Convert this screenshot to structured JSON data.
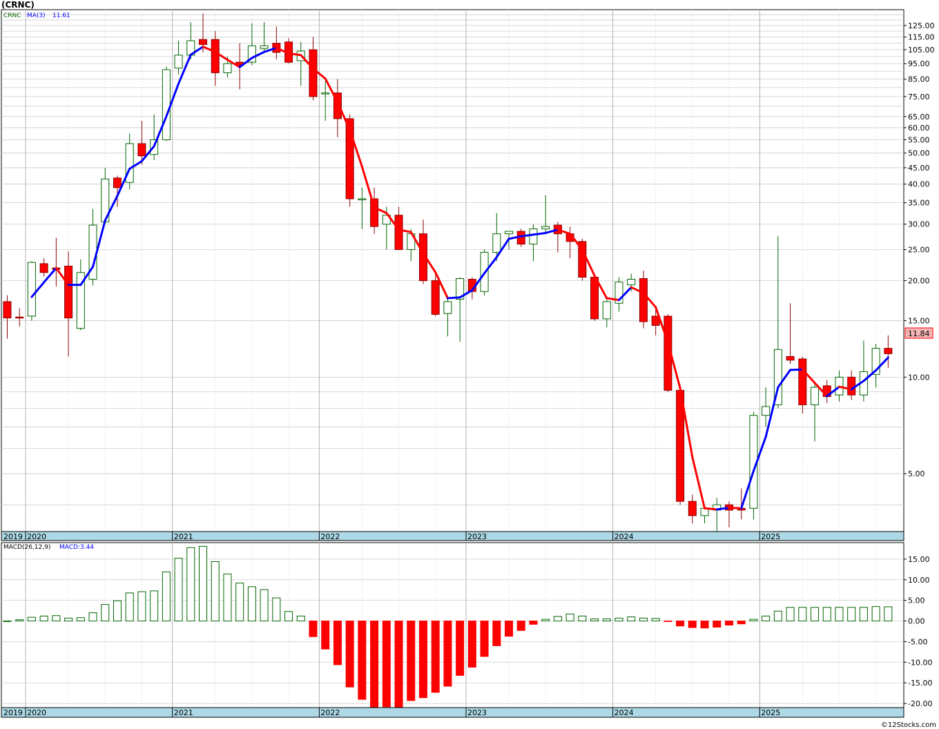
{
  "title": "(CRNC)",
  "watermark": "©12Stocks.com",
  "colors": {
    "up_fill": "#ffffff",
    "up_stroke": "#006400",
    "down_fill": "#ff0000",
    "down_stroke": "#8b0000",
    "ma_up": "#0000ff",
    "ma_down": "#ff0000",
    "grid": "#cccccc",
    "axis_band": "#add8e6",
    "last_price_bg": "#f4b4b4"
  },
  "price_panel": {
    "ticker_label": "CRNC",
    "ma_label": "MA(3)",
    "ma_value": "11.61",
    "last_price": "11.84",
    "y_scale": "log",
    "ylim": [
      3.3,
      140
    ],
    "y_ticks": [
      "125.00",
      "115.00",
      "105.00",
      "95.00",
      "85.00",
      "75.00",
      "65.00",
      "60.00",
      "55.00",
      "50.00",
      "45.00",
      "40.00",
      "35.00",
      "30.00",
      "25.00",
      "20.00",
      "15.00",
      "10.00",
      "5.00"
    ]
  },
  "macd_panel": {
    "label": "MACD(26,12,9)",
    "value_label": "MACD:3.44",
    "ylim": [
      -21,
      19
    ],
    "y_ticks": [
      "15.00",
      "10.00",
      "5.00",
      "0.00",
      "-5.00",
      "-10.00",
      "-15.00",
      "-20.00"
    ]
  },
  "x_axis": {
    "year_labels": [
      "2019",
      "2020",
      "2021",
      "2022",
      "2023",
      "2024",
      "2025"
    ]
  },
  "chart_data": [
    {
      "type": "candlestick",
      "interval": "monthly",
      "ylabel": "",
      "y_scale": "log",
      "series": [
        {
          "date": "2019-11",
          "open": 17.2,
          "high": 18.0,
          "low": 13.2,
          "close": 15.3
        },
        {
          "date": "2019-12",
          "open": 15.4,
          "high": 16.4,
          "low": 14.4,
          "close": 15.3
        },
        {
          "date": "2020-01",
          "open": 15.5,
          "high": 23.0,
          "low": 15.0,
          "close": 22.8
        },
        {
          "date": "2020-02",
          "open": 22.6,
          "high": 23.5,
          "low": 20.6,
          "close": 21.2
        },
        {
          "date": "2020-03",
          "open": 21.9,
          "high": 27.2,
          "low": 19.2,
          "close": 21.7
        },
        {
          "date": "2020-04",
          "open": 22.2,
          "high": 24.7,
          "low": 11.6,
          "close": 15.3
        },
        {
          "date": "2020-05",
          "open": 14.2,
          "high": 23.3,
          "low": 14.0,
          "close": 21.2
        },
        {
          "date": "2020-06",
          "open": 20.2,
          "high": 33.5,
          "low": 19.3,
          "close": 29.8
        },
        {
          "date": "2020-07",
          "open": 30.5,
          "high": 45.0,
          "low": 30.0,
          "close": 41.5
        },
        {
          "date": "2020-08",
          "open": 41.8,
          "high": 42.5,
          "low": 34.0,
          "close": 39.0
        },
        {
          "date": "2020-09",
          "open": 40.5,
          "high": 57.5,
          "low": 38.5,
          "close": 53.5
        },
        {
          "date": "2020-10",
          "open": 53.5,
          "high": 63.0,
          "low": 46.0,
          "close": 49.0
        },
        {
          "date": "2020-11",
          "open": 49.5,
          "high": 66.0,
          "low": 47.5,
          "close": 55.0
        },
        {
          "date": "2020-12",
          "open": 55.0,
          "high": 93.0,
          "low": 54.5,
          "close": 91.0
        },
        {
          "date": "2021-01",
          "open": 92.0,
          "high": 112.0,
          "low": 88.0,
          "close": 101.0
        },
        {
          "date": "2021-02",
          "open": 101.0,
          "high": 128.0,
          "low": 98.0,
          "close": 112.0
        },
        {
          "date": "2021-03",
          "open": 113.0,
          "high": 136.0,
          "low": 103.0,
          "close": 109.0
        },
        {
          "date": "2021-04",
          "open": 113.0,
          "high": 120.0,
          "low": 81.0,
          "close": 89.0
        },
        {
          "date": "2021-05",
          "open": 89.0,
          "high": 100.0,
          "low": 86.0,
          "close": 95.0
        },
        {
          "date": "2021-06",
          "open": 96.0,
          "high": 110.0,
          "low": 79.0,
          "close": 94.0
        },
        {
          "date": "2021-07",
          "open": 96.0,
          "high": 127.0,
          "low": 94.0,
          "close": 108.0
        },
        {
          "date": "2021-08",
          "open": 106.0,
          "high": 128.0,
          "low": 103.0,
          "close": 108.0
        },
        {
          "date": "2021-09",
          "open": 110.0,
          "high": 124.0,
          "low": 98.0,
          "close": 103.0
        },
        {
          "date": "2021-10",
          "open": 111.0,
          "high": 114.0,
          "low": 95.0,
          "close": 96.0
        },
        {
          "date": "2021-11",
          "open": 97.0,
          "high": 111.0,
          "low": 81.0,
          "close": 104.0
        },
        {
          "date": "2021-12",
          "open": 105.0,
          "high": 115.0,
          "low": 73.0,
          "close": 75.0
        },
        {
          "date": "2022-01",
          "open": 77.0,
          "high": 84.0,
          "low": 63.0,
          "close": 77.0
        },
        {
          "date": "2022-02",
          "open": 77.0,
          "high": 85.0,
          "low": 56.0,
          "close": 64.0
        },
        {
          "date": "2022-03",
          "open": 64.0,
          "high": 66.0,
          "low": 34.0,
          "close": 36.0
        },
        {
          "date": "2022-04",
          "open": 36.0,
          "high": 39.0,
          "low": 29.0,
          "close": 36.0
        },
        {
          "date": "2022-05",
          "open": 36.0,
          "high": 39.0,
          "low": 28.0,
          "close": 29.5
        },
        {
          "date": "2022-06",
          "open": 30.0,
          "high": 34.0,
          "low": 25.0,
          "close": 32.0
        },
        {
          "date": "2022-07",
          "open": 32.0,
          "high": 34.0,
          "low": 25.0,
          "close": 25.0
        },
        {
          "date": "2022-08",
          "open": 25.0,
          "high": 29.0,
          "low": 23.0,
          "close": 28.0
        },
        {
          "date": "2022-09",
          "open": 28.0,
          "high": 31.0,
          "low": 19.5,
          "close": 20.0
        },
        {
          "date": "2022-10",
          "open": 20.0,
          "high": 21.0,
          "low": 15.5,
          "close": 15.7
        },
        {
          "date": "2022-11",
          "open": 15.8,
          "high": 18.0,
          "low": 13.4,
          "close": 17.2
        },
        {
          "date": "2022-12",
          "open": 17.5,
          "high": 20.5,
          "low": 12.9,
          "close": 20.3
        },
        {
          "date": "2023-01",
          "open": 20.2,
          "high": 20.5,
          "low": 17.5,
          "close": 18.5
        },
        {
          "date": "2023-02",
          "open": 18.5,
          "high": 25.0,
          "low": 18.0,
          "close": 24.5
        },
        {
          "date": "2023-03",
          "open": 24.5,
          "high": 32.5,
          "low": 23.0,
          "close": 28.0
        },
        {
          "date": "2023-04",
          "open": 28.0,
          "high": 28.5,
          "low": 25.0,
          "close": 28.5
        },
        {
          "date": "2023-05",
          "open": 28.5,
          "high": 29.0,
          "low": 25.5,
          "close": 26.0
        },
        {
          "date": "2023-06",
          "open": 26.0,
          "high": 30.0,
          "low": 23.0,
          "close": 29.0
        },
        {
          "date": "2023-07",
          "open": 29.0,
          "high": 37.0,
          "low": 28.0,
          "close": 29.5
        },
        {
          "date": "2023-08",
          "open": 29.8,
          "high": 30.5,
          "low": 24.5,
          "close": 28.0
        },
        {
          "date": "2023-09",
          "open": 28.0,
          "high": 29.5,
          "low": 23.5,
          "close": 26.5
        },
        {
          "date": "2023-10",
          "open": 26.5,
          "high": 27.0,
          "low": 20.0,
          "close": 20.5
        },
        {
          "date": "2023-11",
          "open": 20.5,
          "high": 21.0,
          "low": 15.0,
          "close": 15.2
        },
        {
          "date": "2023-12",
          "open": 15.2,
          "high": 17.5,
          "low": 14.3,
          "close": 17.2
        },
        {
          "date": "2024-01",
          "open": 17.0,
          "high": 20.5,
          "low": 16.0,
          "close": 19.8
        },
        {
          "date": "2024-02",
          "open": 19.4,
          "high": 21.0,
          "low": 18.5,
          "close": 20.2
        },
        {
          "date": "2024-03",
          "open": 20.3,
          "high": 21.5,
          "low": 14.2,
          "close": 14.9
        },
        {
          "date": "2024-04",
          "open": 15.5,
          "high": 16.5,
          "low": 13.5,
          "close": 14.5
        },
        {
          "date": "2024-05",
          "open": 15.5,
          "high": 15.7,
          "low": 9.0,
          "close": 9.1
        },
        {
          "date": "2024-06",
          "open": 9.1,
          "high": 9.5,
          "low": 4.0,
          "close": 4.1
        },
        {
          "date": "2024-07",
          "open": 4.1,
          "high": 4.3,
          "low": 3.5,
          "close": 3.7
        },
        {
          "date": "2024-08",
          "open": 3.7,
          "high": 3.9,
          "low": 3.5,
          "close": 3.9
        },
        {
          "date": "2024-09",
          "open": 3.85,
          "high": 4.2,
          "low": 3.3,
          "close": 4.0
        },
        {
          "date": "2024-10",
          "open": 4.0,
          "high": 4.1,
          "low": 3.4,
          "close": 3.85
        },
        {
          "date": "2024-11",
          "open": 3.9,
          "high": 4.5,
          "low": 3.6,
          "close": 3.85
        },
        {
          "date": "2024-12",
          "open": 3.9,
          "high": 7.8,
          "low": 3.6,
          "close": 7.6
        },
        {
          "date": "2025-01",
          "open": 7.6,
          "high": 9.3,
          "low": 7.0,
          "close": 8.1
        },
        {
          "date": "2025-02",
          "open": 8.2,
          "high": 27.5,
          "low": 8.0,
          "close": 12.2
        },
        {
          "date": "2025-03",
          "open": 11.6,
          "high": 17.0,
          "low": 11.0,
          "close": 11.3
        },
        {
          "date": "2025-04",
          "open": 11.4,
          "high": 11.6,
          "low": 7.7,
          "close": 8.2
        },
        {
          "date": "2025-05",
          "open": 8.2,
          "high": 9.5,
          "low": 6.3,
          "close": 9.3
        },
        {
          "date": "2025-06",
          "open": 9.4,
          "high": 9.8,
          "low": 8.3,
          "close": 8.7
        },
        {
          "date": "2025-07",
          "open": 8.8,
          "high": 10.5,
          "low": 8.4,
          "close": 10.0
        },
        {
          "date": "2025-08",
          "open": 10.0,
          "high": 10.5,
          "low": 8.5,
          "close": 8.8
        },
        {
          "date": "2025-09",
          "open": 8.8,
          "high": 13.0,
          "low": 8.4,
          "close": 10.4
        },
        {
          "date": "2025-10",
          "open": 10.2,
          "high": 12.7,
          "low": 9.3,
          "close": 12.3
        },
        {
          "date": "2025-11",
          "open": 12.3,
          "high": 13.5,
          "low": 10.7,
          "close": 11.84
        }
      ]
    },
    {
      "type": "bar",
      "title": "",
      "ylabel": "",
      "ylim": [
        -21,
        19
      ],
      "series": [
        {
          "date": "2019-11",
          "value": 0.0
        },
        {
          "date": "2019-12",
          "value": 0.3
        },
        {
          "date": "2020-01",
          "value": 0.9
        },
        {
          "date": "2020-02",
          "value": 1.2
        },
        {
          "date": "2020-03",
          "value": 1.3
        },
        {
          "date": "2020-04",
          "value": 0.7
        },
        {
          "date": "2020-05",
          "value": 0.8
        },
        {
          "date": "2020-06",
          "value": 2.0
        },
        {
          "date": "2020-07",
          "value": 4.0
        },
        {
          "date": "2020-08",
          "value": 4.9
        },
        {
          "date": "2020-09",
          "value": 6.8
        },
        {
          "date": "2020-10",
          "value": 7.1
        },
        {
          "date": "2020-11",
          "value": 7.3
        },
        {
          "date": "2020-12",
          "value": 11.9
        },
        {
          "date": "2021-01",
          "value": 15.2
        },
        {
          "date": "2021-02",
          "value": 17.8
        },
        {
          "date": "2021-03",
          "value": 18.1
        },
        {
          "date": "2021-04",
          "value": 14.4
        },
        {
          "date": "2021-05",
          "value": 11.4
        },
        {
          "date": "2021-06",
          "value": 9.2
        },
        {
          "date": "2021-07",
          "value": 8.3
        },
        {
          "date": "2021-08",
          "value": 7.6
        },
        {
          "date": "2021-09",
          "value": 5.6
        },
        {
          "date": "2021-10",
          "value": 2.3
        },
        {
          "date": "2021-11",
          "value": 1.2
        },
        {
          "date": "2021-12",
          "value": -3.8
        },
        {
          "date": "2022-01",
          "value": -6.8
        },
        {
          "date": "2022-02",
          "value": -10.6
        },
        {
          "date": "2022-03",
          "value": -16.0
        },
        {
          "date": "2022-04",
          "value": -19.0
        },
        {
          "date": "2022-05",
          "value": -21.0
        },
        {
          "date": "2022-06",
          "value": -20.8
        },
        {
          "date": "2022-07",
          "value": -21.0
        },
        {
          "date": "2022-08",
          "value": -19.3
        },
        {
          "date": "2022-09",
          "value": -18.6
        },
        {
          "date": "2022-10",
          "value": -17.3
        },
        {
          "date": "2022-11",
          "value": -15.8
        },
        {
          "date": "2022-12",
          "value": -13.2
        },
        {
          "date": "2023-01",
          "value": -11.2
        },
        {
          "date": "2023-02",
          "value": -8.6
        },
        {
          "date": "2023-03",
          "value": -6.0
        },
        {
          "date": "2023-04",
          "value": -3.7
        },
        {
          "date": "2023-05",
          "value": -2.3
        },
        {
          "date": "2023-06",
          "value": -0.8
        },
        {
          "date": "2023-07",
          "value": 0.4
        },
        {
          "date": "2023-08",
          "value": 1.1
        },
        {
          "date": "2023-09",
          "value": 1.7
        },
        {
          "date": "2023-10",
          "value": 1.2
        },
        {
          "date": "2023-11",
          "value": 0.5
        },
        {
          "date": "2023-12",
          "value": 0.5
        },
        {
          "date": "2024-01",
          "value": 0.7
        },
        {
          "date": "2024-02",
          "value": 1.0
        },
        {
          "date": "2024-03",
          "value": 0.7
        },
        {
          "date": "2024-04",
          "value": 0.6
        },
        {
          "date": "2024-05",
          "value": -0.1
        },
        {
          "date": "2024-06",
          "value": -1.2
        },
        {
          "date": "2024-07",
          "value": -1.6
        },
        {
          "date": "2024-08",
          "value": -1.7
        },
        {
          "date": "2024-09",
          "value": -1.5
        },
        {
          "date": "2024-10",
          "value": -1.0
        },
        {
          "date": "2024-11",
          "value": -0.7
        },
        {
          "date": "2024-12",
          "value": 0.4
        },
        {
          "date": "2025-01",
          "value": 1.2
        },
        {
          "date": "2025-02",
          "value": 2.4
        },
        {
          "date": "2025-03",
          "value": 3.3
        },
        {
          "date": "2025-04",
          "value": 3.3
        },
        {
          "date": "2025-05",
          "value": 3.3
        },
        {
          "date": "2025-06",
          "value": 3.3
        },
        {
          "date": "2025-07",
          "value": 3.3
        },
        {
          "date": "2025-08",
          "value": 3.3
        },
        {
          "date": "2025-09",
          "value": 3.3
        },
        {
          "date": "2025-10",
          "value": 3.5
        },
        {
          "date": "2025-11",
          "value": 3.44
        }
      ]
    }
  ]
}
